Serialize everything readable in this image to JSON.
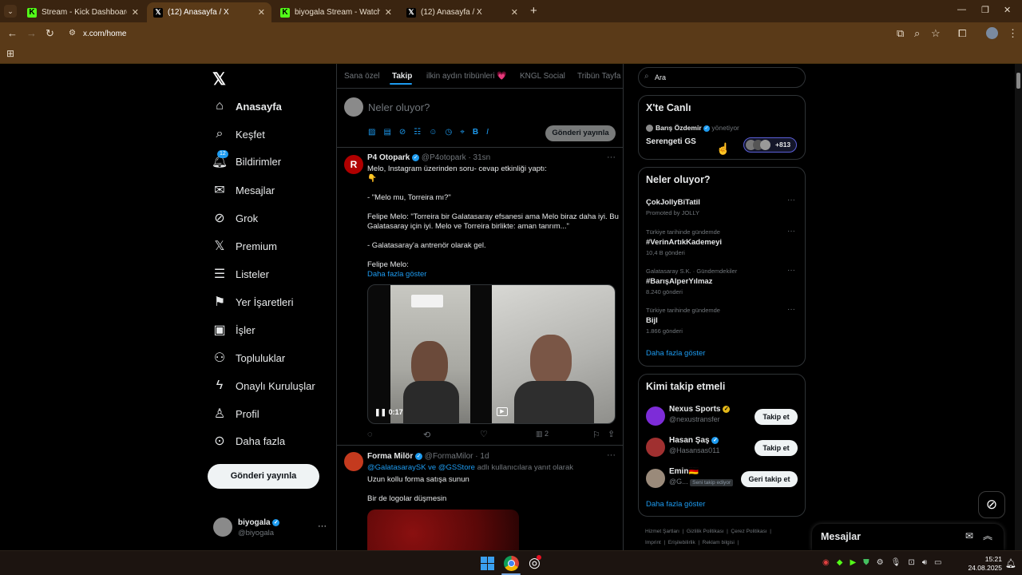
{
  "browser": {
    "tabs": [
      {
        "title": "Stream - Kick Dashboard",
        "icon": "kick"
      },
      {
        "title": "(12) Anasayfa / X",
        "icon": "x"
      },
      {
        "title": "biyogala Stream - Watch Live o",
        "icon": "kick"
      },
      {
        "title": "(12) Anasayfa / X",
        "icon": "x"
      }
    ],
    "url": "x.com/home"
  },
  "nav": {
    "items": [
      "Anasayfa",
      "Keşfet",
      "Bildirimler",
      "Mesajlar",
      "Grok",
      "Premium",
      "Listeler",
      "Yer İşaretleri",
      "İşler",
      "Topluluklar",
      "Onaylı Kuruluşlar",
      "Profil",
      "Daha fazla"
    ],
    "notif_badge": "12",
    "post_button": "Gönderi yayınla",
    "user": {
      "name": "biyogala",
      "handle": "@biyogala"
    }
  },
  "feed_tabs": [
    "Sana özel",
    "Takip",
    "ilkin aydın tribünleri 💗",
    "KNGL Social",
    "Tribün Tayfa"
  ],
  "composer": {
    "placeholder": "Neler oluyor?",
    "post_label": "Gönderi yayınla"
  },
  "tweet1": {
    "name": "P4 Otopark",
    "handle": "@P4otopark · 31sn",
    "lines": [
      "Melo, Instagram üzerinden soru- cevap etkinliği yaptı:",
      "👇",
      "",
      "- \"Melo mu, Torreira mı?\"",
      "",
      "Felipe Melo: \"Torreira bir Galatasaray efsanesi ama Melo biraz daha iyi. Bu Galatasaray için iyi. Melo ve Torreira birlikte: aman tanrım...\"",
      "",
      "- Galatasaray'a antrenör olarak gel.",
      "",
      "Felipe Melo:"
    ],
    "show_more": "Daha fazla göster",
    "video_time": "0:17",
    "views": "2"
  },
  "tweet2": {
    "name": "Forma Milör",
    "handle": "@FormaMilor · 1d",
    "reply_to_a": "@GalatasaraySK ve @GSStore",
    "reply_to_b": " adlı kullanıcılara yanıt olarak",
    "line1": "Uzun kollu forma satışa sunun",
    "line2": "Bir de logolar düşmesin"
  },
  "search": {
    "placeholder": "Ara"
  },
  "live": {
    "title": "X'te Canlı",
    "host": "Barış Özdemir",
    "role": "yönetiyor",
    "space": "Serengeti GS",
    "count": "+813"
  },
  "trends": {
    "title": "Neler oluyor?",
    "items": [
      {
        "context": "",
        "name": "ÇokJollyBiTatil",
        "meta": "Promoted by JOLLY"
      },
      {
        "context": "Türkiye tarihinde gündemde",
        "name": "#VerinArtıkKademeyi",
        "meta": "10,4 B gönderi"
      },
      {
        "context": "Galatasaray S.K. · Gündemdekiler",
        "name": "#BarışAlperYılmaz",
        "meta": "8.240 gönderi"
      },
      {
        "context": "Türkiye tarihinde gündemde",
        "name": "Bijl",
        "meta": "1.866 gönderi"
      }
    ],
    "more": "Daha fazla göster"
  },
  "wtf": {
    "title": "Kimi takip etmeli",
    "items": [
      {
        "name": "Nexus Sports",
        "handle": "@nexustransfer",
        "button": "Takip et"
      },
      {
        "name": "Hasan Şaş",
        "handle": "@Hasansas011",
        "button": "Takip et"
      },
      {
        "name": "Emin🇩🇪",
        "handle": "@G...",
        "badge": "Seni takip ediyor",
        "button": "Geri takip et"
      }
    ],
    "more": "Daha fazla göster"
  },
  "footer": [
    "Hizmet Şartları",
    "Gizlilik Politikası",
    "Çerez Politikası",
    "Imprint",
    "Erişilebilirlik",
    "Reklam bilgisi"
  ],
  "messages": {
    "title": "Mesajlar"
  },
  "clock": {
    "time": "15:21",
    "date": "24.08.2025"
  }
}
